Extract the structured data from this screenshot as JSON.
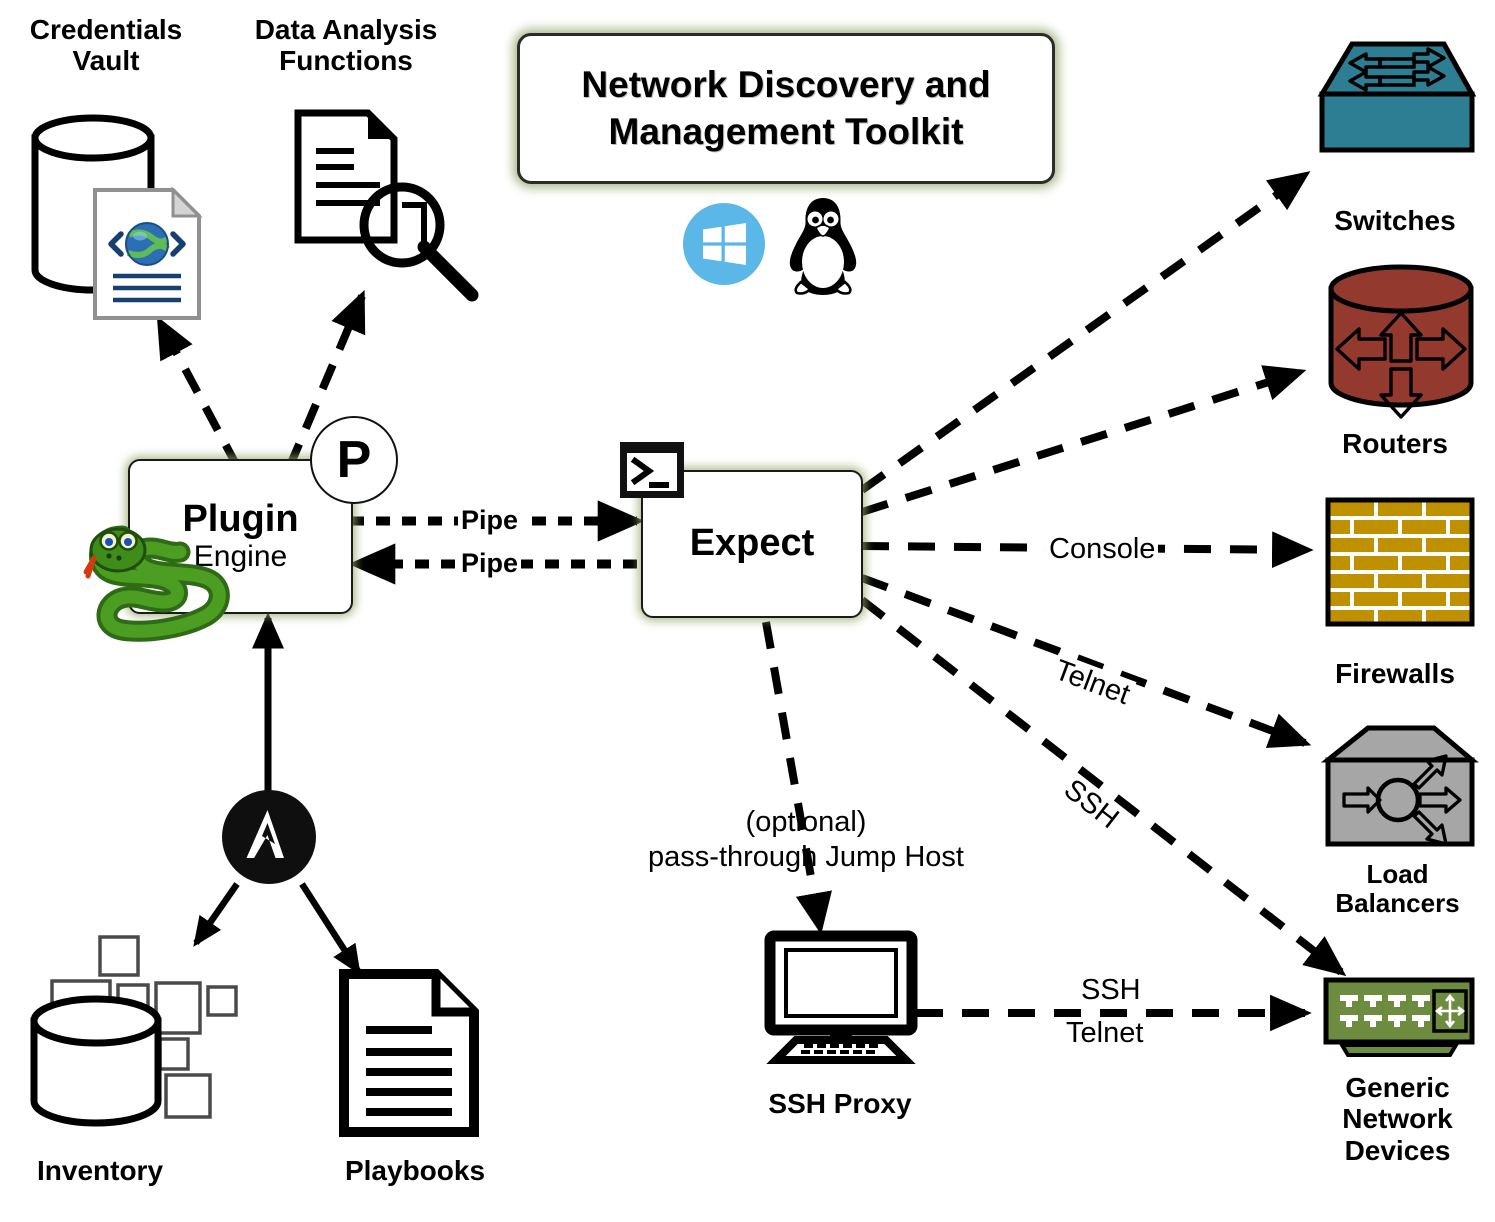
{
  "title": {
    "text": "Network Discovery and\nManagement Toolkit",
    "platform_icons": [
      "windows-logo-icon",
      "linux-penguin-icon"
    ]
  },
  "nodes": {
    "credentials_vault": {
      "label": "Credentials\nVault",
      "icon": "database-with-xml-document-icon"
    },
    "data_analysis": {
      "label": "Data Analysis\nFunctions",
      "icon": "document-with-magnifier-icon"
    },
    "plugin_engine": {
      "title": "Plugin",
      "subtitle": "Engine",
      "badge": "P",
      "mascot": "python-snake-icon"
    },
    "expect": {
      "title": "Expect",
      "icon": "terminal-prompt-icon"
    },
    "ansible": {
      "icon": "ansible-logo-icon"
    },
    "inventory": {
      "label": "Inventory",
      "icon": "database-with-nodes-icon"
    },
    "playbooks": {
      "label": "Playbooks",
      "icon": "document-icon"
    },
    "ssh_proxy": {
      "label": "SSH Proxy",
      "icon": "desktop-computer-icon",
      "note": "(optional)\npass-through Jump Host"
    }
  },
  "devices": [
    {
      "label": "Switches",
      "icon": "switch-icon",
      "color": "#2E7E93"
    },
    {
      "label": "Routers",
      "icon": "router-icon",
      "color": "#93392E"
    },
    {
      "label": "Firewalls",
      "icon": "firewall-brick-icon",
      "color": "#BF9000"
    },
    {
      "label": "Load\nBalancers",
      "icon": "load-balancer-icon",
      "color": "#A6A6A6"
    },
    {
      "label": "Generic\nNetwork\nDevices",
      "icon": "generic-network-device-icon",
      "color": "#6D8C3F"
    }
  ],
  "edges": {
    "pipe_out": "Pipe",
    "pipe_in": "Pipe",
    "console": "Console",
    "telnet": "Telnet",
    "ssh": "SSH",
    "proxy_ssh": "SSH",
    "proxy_telnet": "Telnet"
  },
  "colors": {
    "switch": "#2E7E93",
    "router": "#93392E",
    "firewall": "#BF9000",
    "load_balancer": "#A6A6A6",
    "generic_device": "#6D8C3F",
    "glow": "#96A86E",
    "windows_blue": "#5BB7E8",
    "python_green": "#3C7A1E",
    "stroke": "#000000"
  }
}
